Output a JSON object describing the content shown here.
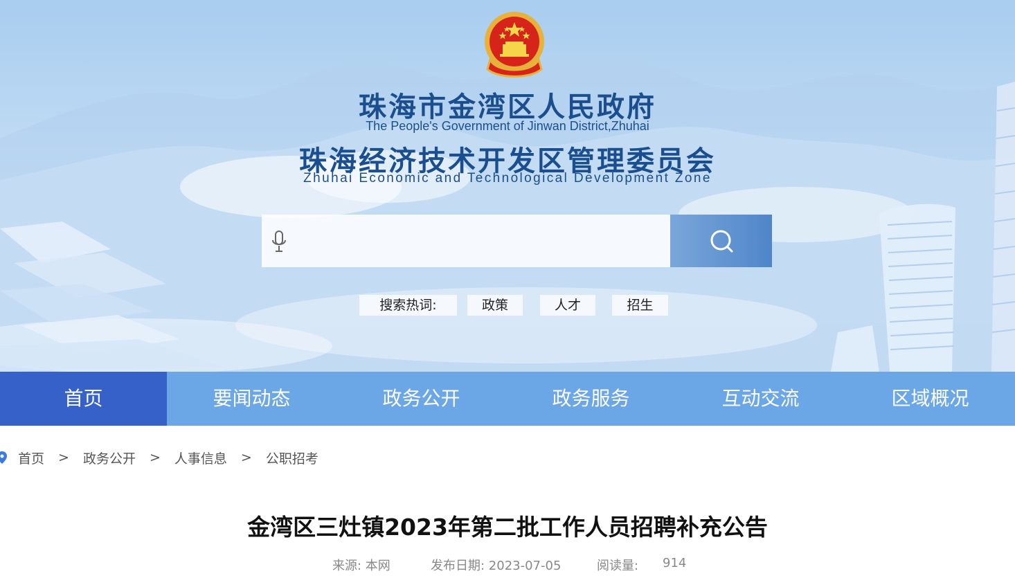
{
  "header": {
    "title_cn": "珠海市金湾区人民政府",
    "title_en": "The People's Government of Jinwan District,Zhuhai",
    "subtitle_cn": "珠海经济技术开发区管理委员会",
    "subtitle_en": "Zhuhai Economic and Technological Development Zone"
  },
  "search": {
    "placeholder": "",
    "hot_label": "搜索热词:",
    "hot_words": [
      "政策",
      "人才",
      "招生"
    ]
  },
  "nav": {
    "items": [
      "首页",
      "要闻动态",
      "政务公开",
      "政务服务",
      "互动交流",
      "区域概况"
    ],
    "active": "首页"
  },
  "breadcrumb": [
    "首页",
    "政务公开",
    "人事信息",
    "公职招考"
  ],
  "breadcrumb_sep": ">",
  "article": {
    "title": "金湾区三灶镇2023年第二批工作人员招聘补充公告",
    "source": "来源: 本网",
    "date": "发布日期: 2023-07-05",
    "views_label": "阅读量:",
    "views": "914"
  },
  "colors": {
    "nav_bg": "#6ba6e6",
    "nav_active": "#3561c8",
    "title_blue": "#1b4e8f"
  }
}
